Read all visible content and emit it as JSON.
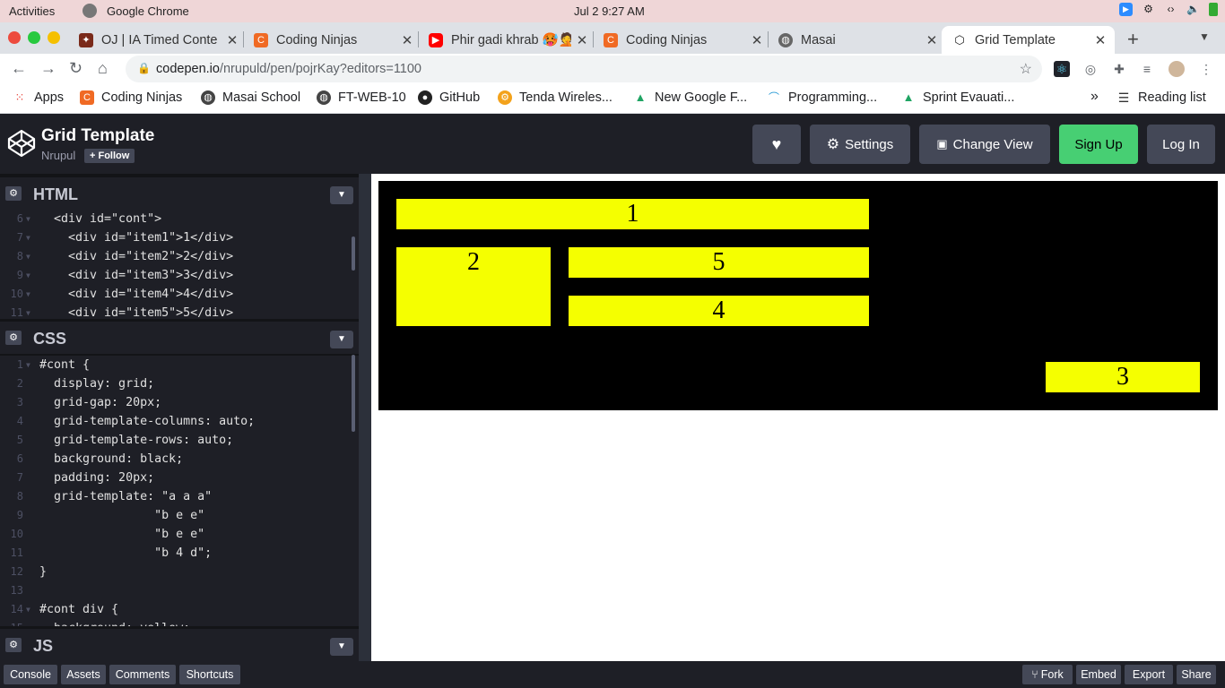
{
  "system_bar": {
    "activities": "Activities",
    "app_name": "Google Chrome",
    "clock": "Jul 2   9:27 AM"
  },
  "tabs": [
    {
      "label": "OJ | IA Timed Conte",
      "icon": "kite-icon",
      "active": false
    },
    {
      "label": "Coding Ninjas",
      "icon": "coding-ninjas-icon",
      "active": false
    },
    {
      "label": "Phir gadi khrab 🥵🤦",
      "icon": "youtube-icon",
      "active": false
    },
    {
      "label": "Coding Ninjas",
      "icon": "coding-ninjas-icon",
      "active": false
    },
    {
      "label": "Masai",
      "icon": "globe-icon",
      "active": false
    },
    {
      "label": "Grid Template",
      "icon": "codepen-icon",
      "active": true
    }
  ],
  "omnibox": {
    "domain": "codepen.io",
    "path": "/nrupuld/pen/pojrKay?editors=1100"
  },
  "bookmarks": [
    {
      "label": "Apps",
      "icon": "apps-grid-icon"
    },
    {
      "label": "Coding Ninjas",
      "icon": "coding-ninjas-icon"
    },
    {
      "label": "Masai School",
      "icon": "globe-icon"
    },
    {
      "label": "FT-WEB-10",
      "icon": "globe-icon"
    },
    {
      "label": "GitHub",
      "icon": "github-icon"
    },
    {
      "label": "Tenda Wireles...",
      "icon": "tenda-icon"
    },
    {
      "label": "New Google F...",
      "icon": "google-drive-icon"
    },
    {
      "label": "Programming...",
      "icon": "rainbow-icon"
    },
    {
      "label": "Sprint Evauati...",
      "icon": "google-drive-icon"
    }
  ],
  "bookmarks_more": "»",
  "reading_list": "Reading list",
  "codepen": {
    "title": "Grid Template",
    "user": "Nrupul",
    "follow": "+ Follow",
    "settings": "Settings",
    "change_view": "Change View",
    "sign_up": "Sign Up",
    "log_in": "Log In"
  },
  "html_panel": {
    "title": "HTML",
    "lines": [
      {
        "n": "6",
        "text": "  <div id=\"cont\">"
      },
      {
        "n": "7",
        "text": "    <div id=\"item1\">1</div>"
      },
      {
        "n": "8",
        "text": "    <div id=\"item2\">2</div>"
      },
      {
        "n": "9",
        "text": "    <div id=\"item3\">3</div>"
      },
      {
        "n": "10",
        "text": "    <div id=\"item4\">4</div>"
      },
      {
        "n": "11",
        "text": "    <div id=\"item5\">5</div>"
      }
    ]
  },
  "css_panel": {
    "title": "CSS",
    "lines": [
      {
        "n": "1",
        "text": "#cont {"
      },
      {
        "n": "2",
        "text": "  display: grid;"
      },
      {
        "n": "3",
        "text": "  grid-gap: 20px;"
      },
      {
        "n": "4",
        "text": "  grid-template-columns: auto;"
      },
      {
        "n": "5",
        "text": "  grid-template-rows: auto;"
      },
      {
        "n": "6",
        "text": "  background: black;"
      },
      {
        "n": "7",
        "text": "  padding: 20px;"
      },
      {
        "n": "8",
        "text": "  grid-template: \"a a a\""
      },
      {
        "n": "9",
        "text": "                \"b e e\""
      },
      {
        "n": "10",
        "text": "                \"b e e\""
      },
      {
        "n": "11",
        "text": "                \"b 4 d\";"
      },
      {
        "n": "12",
        "text": "}"
      },
      {
        "n": "13",
        "text": ""
      },
      {
        "n": "14",
        "text": "#cont div {"
      },
      {
        "n": "15",
        "text": "  background: yellow;"
      }
    ]
  },
  "js_panel": {
    "title": "JS"
  },
  "preview": {
    "colors": {
      "container": "#000000",
      "item": "#f5ff00"
    },
    "items": [
      {
        "id": "item1",
        "label": "1"
      },
      {
        "id": "item2",
        "label": "2"
      },
      {
        "id": "item5",
        "label": "5"
      },
      {
        "id": "item4",
        "label": "4"
      },
      {
        "id": "item3",
        "label": "3"
      }
    ]
  },
  "footer": {
    "left": [
      "Console",
      "Assets",
      "Comments",
      "Shortcuts"
    ],
    "fork": "Fork",
    "embed": "Embed",
    "export": "Export",
    "share": "Share"
  }
}
